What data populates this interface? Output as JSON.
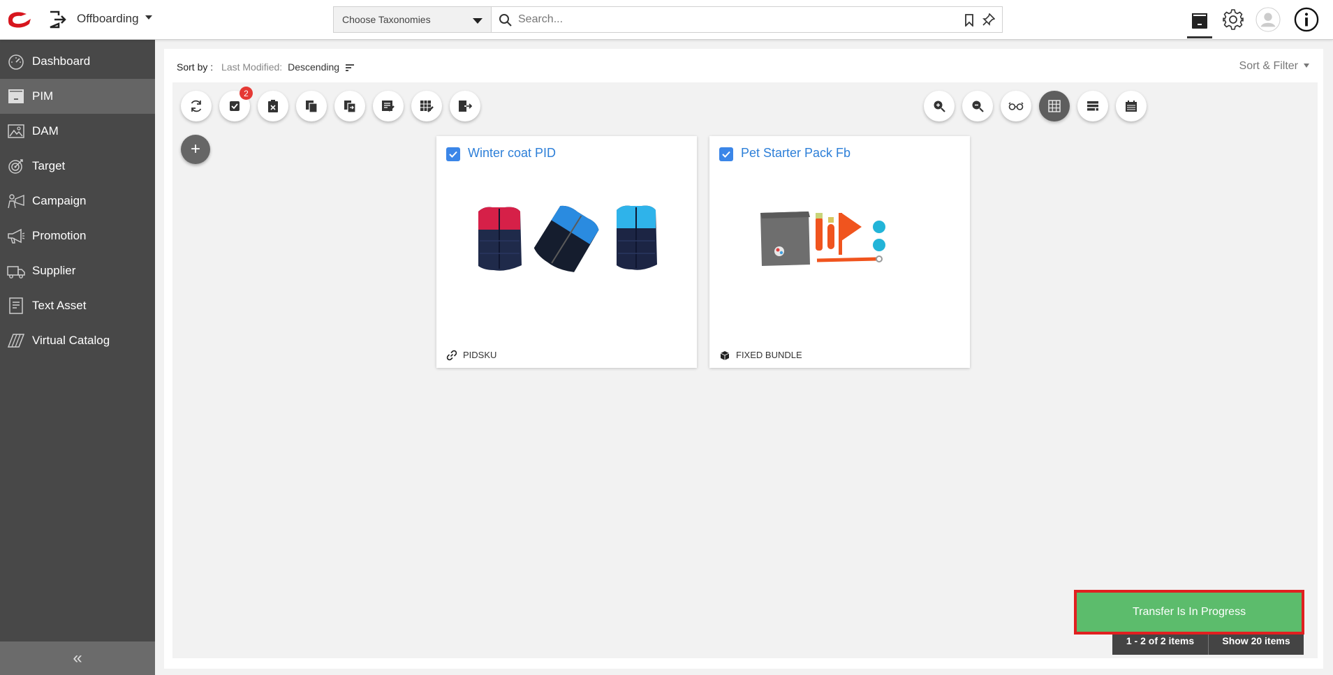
{
  "header": {
    "module_name": "Offboarding",
    "taxonomy_placeholder": "Choose Taxonomies",
    "search_placeholder": "Search..."
  },
  "sidebar": {
    "items": [
      {
        "label": "Dashboard",
        "icon": "dashboard-icon"
      },
      {
        "label": "PIM",
        "icon": "pim-icon",
        "active": true
      },
      {
        "label": "DAM",
        "icon": "image-icon"
      },
      {
        "label": "Target",
        "icon": "target-icon"
      },
      {
        "label": "Campaign",
        "icon": "campaign-icon"
      },
      {
        "label": "Promotion",
        "icon": "megaphone-icon"
      },
      {
        "label": "Supplier",
        "icon": "truck-icon"
      },
      {
        "label": "Text Asset",
        "icon": "document-icon"
      },
      {
        "label": "Virtual Catalog",
        "icon": "catalog-icon"
      }
    ],
    "collapse_glyph": "«"
  },
  "sortbar": {
    "label": "Sort by :",
    "field": "Last Modified:",
    "order": "Descending",
    "sort_filter": "Sort & Filter"
  },
  "toolbar": {
    "selected_badge": "2",
    "add_glyph": "+"
  },
  "products": [
    {
      "name": "Winter coat PID",
      "type": "PIDSKU",
      "type_icon": "link-icon",
      "checked": true
    },
    {
      "name": "Pet Starter Pack Fb",
      "type": "FIXED BUNDLE",
      "type_icon": "box-icon",
      "checked": true
    }
  ],
  "pager": {
    "count": "1 - 2 of 2 items",
    "show": "Show 20 items"
  },
  "toast": {
    "message": "Transfer Is In Progress"
  },
  "colors": {
    "sidebar_bg": "#484848",
    "sidebar_active": "#656565",
    "link_blue": "#2d7fd8",
    "badge_red": "#e53935",
    "toast_green": "#5cbc6c",
    "toast_border": "#e02020"
  }
}
